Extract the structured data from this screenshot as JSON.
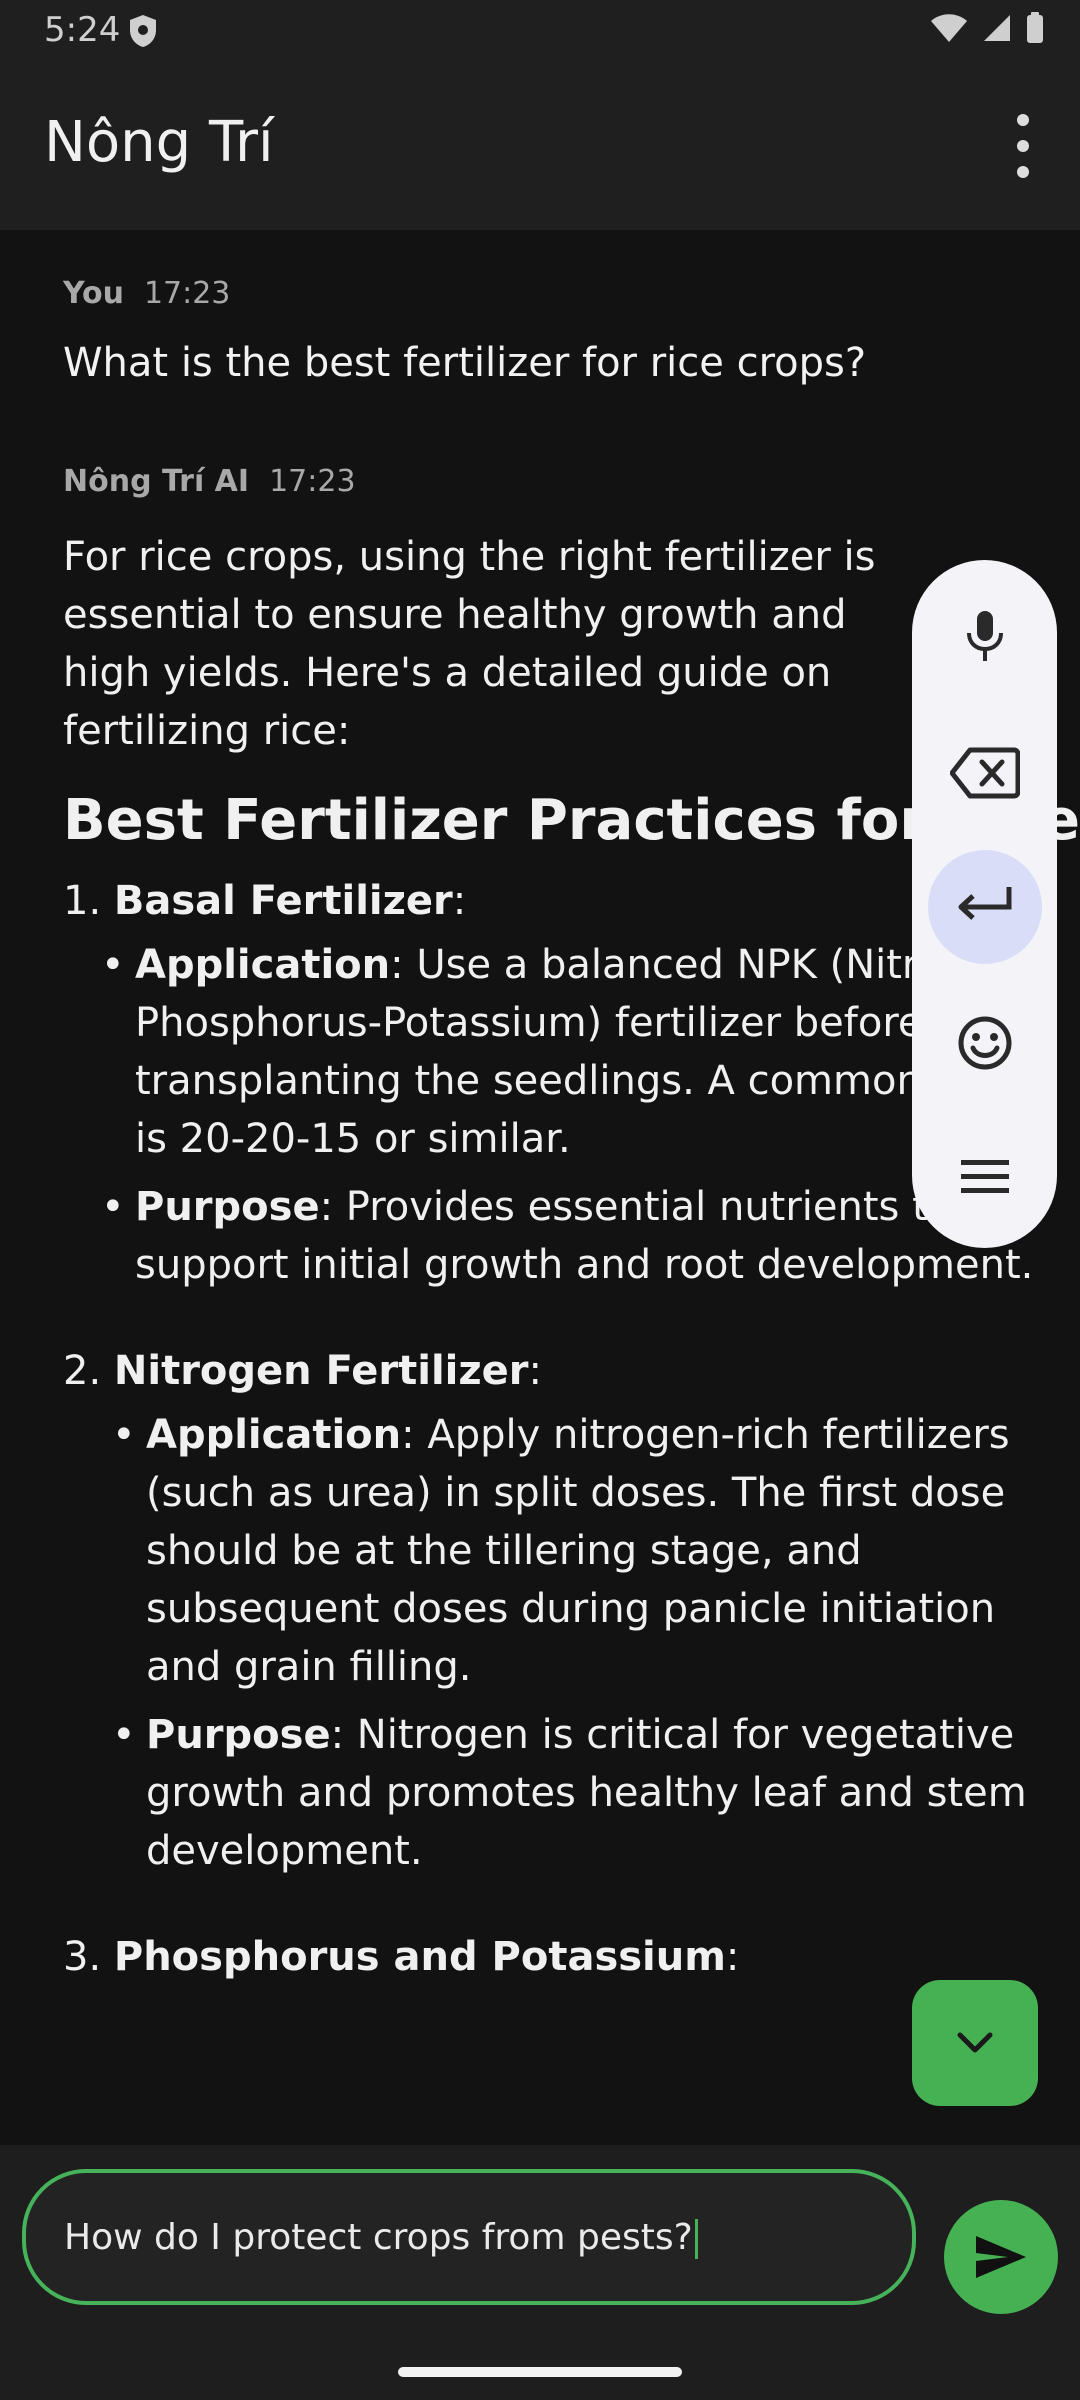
{
  "status_bar": {
    "time": "5:24"
  },
  "app_bar": {
    "title": "Nông Trí"
  },
  "messages": {
    "user": {
      "sender": "You",
      "time": "17:23",
      "text": "What is the best fertilizer for rice crops?"
    },
    "ai": {
      "sender": "Nông Trí AI",
      "time": "17:23",
      "intro": "For rice crops, using the right fertilizer is essential to ensure healthy growth and high yields. Here's a detailed guide on fertilizing rice:",
      "heading": "Best Fertilizer Practices for Rice",
      "sections": [
        {
          "number": "1.",
          "title": "Basal Fertilizer",
          "bullets": [
            {
              "label": "Application",
              "text": "Use a balanced NPK (Nitrogen-Phosphorus-Potassium) fertilizer before transplanting the seedlings. A common ratio is 20-20-15 or similar."
            },
            {
              "label": "Purpose",
              "text": "Provides essential nutrients to support initial growth and root development."
            }
          ]
        },
        {
          "number": "2.",
          "title": "Nitrogen Fertilizer",
          "bullets": [
            {
              "label": "Application",
              "text": "Apply nitrogen-rich fertilizers (such as urea) in split doses. The first dose should be at the tillering stage, and subsequent doses during panicle initiation and grain filling."
            },
            {
              "label": "Purpose",
              "text": "Nitrogen is critical for vegetative growth and promotes healthy leaf and stem development."
            }
          ]
        },
        {
          "number": "3.",
          "title": "Phosphorus and Potassium"
        }
      ]
    }
  },
  "keyboard_toolbar": {
    "buttons": [
      {
        "icon": "microphone-icon"
      },
      {
        "icon": "backspace-icon"
      },
      {
        "icon": "enter-icon",
        "active": true
      },
      {
        "icon": "emoji-icon"
      },
      {
        "icon": "menu-icon"
      }
    ]
  },
  "scroll_button": {
    "icon": "chevron-down-icon"
  },
  "composer": {
    "value": "How do I protect crops from pests?",
    "send_icon": "send-icon"
  },
  "colors": {
    "accent": "#45b152",
    "background": "#121212",
    "bar": "#1f1f1f",
    "toolbar": "#f4f4f8",
    "toolbar_active": "#d9ddf7"
  }
}
